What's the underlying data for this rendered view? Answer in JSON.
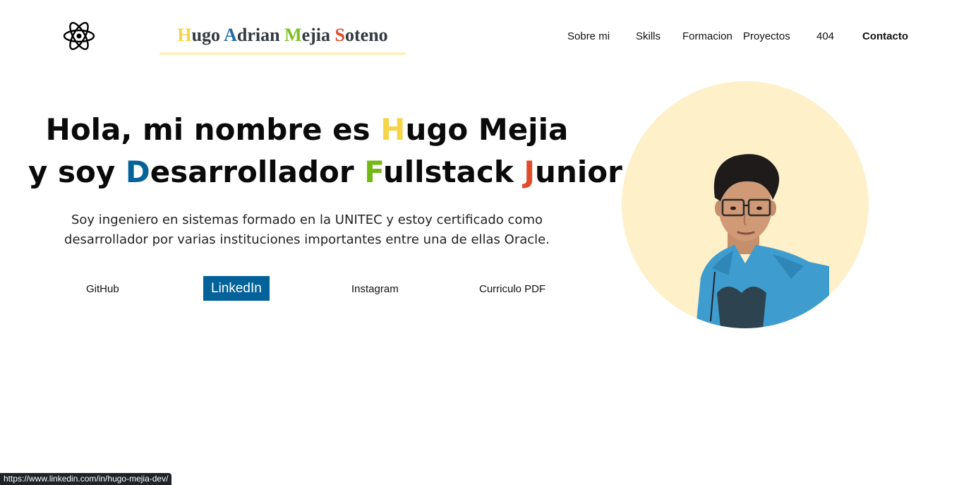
{
  "header": {
    "brand": {
      "parts": [
        {
          "text": "H",
          "color": "#f5d547"
        },
        {
          "text": "ugo ",
          "color": "#333a40"
        },
        {
          "text": "A",
          "color": "#1b6aa6"
        },
        {
          "text": "drian ",
          "color": "#333a40"
        },
        {
          "text": "M",
          "color": "#7cc022"
        },
        {
          "text": "ejia ",
          "color": "#333a40"
        },
        {
          "text": "S",
          "color": "#e04b2a"
        },
        {
          "text": "oteno",
          "color": "#333a40"
        }
      ]
    },
    "logo_icon": "react-atom-icon",
    "nav": {
      "sobre_mi": "Sobre mi",
      "skills": "Skills",
      "formacion": "Formacion",
      "proyectos": "Proyectos",
      "error_404": "404",
      "contacto": "Contacto"
    }
  },
  "hero": {
    "title_line1": {
      "before": "Hola, mi nombre es ",
      "accent": "H",
      "after": "ugo Mejia"
    },
    "title_line2": {
      "prefix": "y soy ",
      "accent1": "D",
      "word1": "esarrollador ",
      "accent2": "F",
      "word2": "ullstack ",
      "accent3": "J",
      "word3": "unior"
    },
    "description": "Soy ingeniero en sistemas formado en la UNITEC y estoy certificado como desarrollador por varias instituciones importantes entre una de ellas Oracle.",
    "links": {
      "github": "GitHub",
      "linkedin": "LinkedIn",
      "instagram": "Instagram",
      "cv": "Curriculo PDF"
    }
  },
  "colors": {
    "yellow": "#f5d547",
    "blue": "#04629a",
    "green": "#74b816",
    "red": "#e04b2a",
    "circle_bg": "#fef0c9",
    "linkedin_bg": "#04629a"
  },
  "status_bar": {
    "url": "https://www.linkedin.com/in/hugo-mejia-dev/"
  }
}
